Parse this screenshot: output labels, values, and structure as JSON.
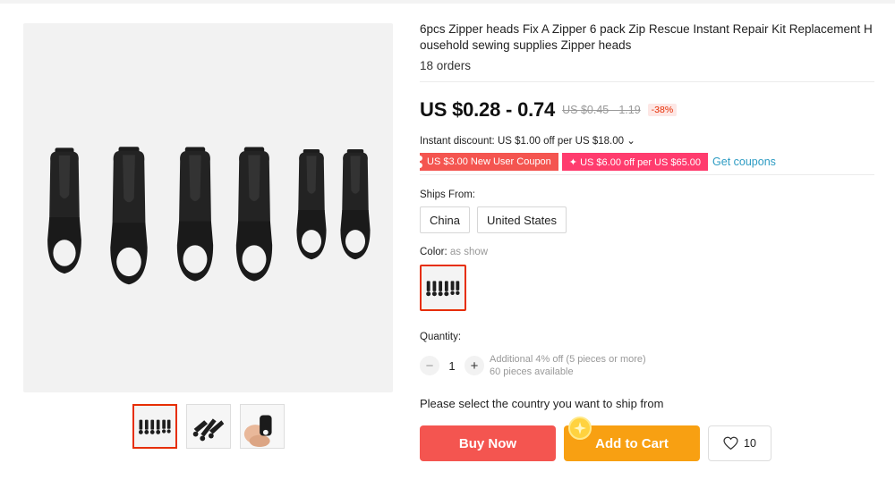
{
  "product": {
    "title": "6pcs Zipper heads Fix A Zipper 6 pack Zip Rescue Instant Repair Kit Replacement Household sewing supplies Zipper heads",
    "orders": "18 orders"
  },
  "gallery": {
    "main_image": "six-black-zipper-pulls",
    "thumbnails": [
      {
        "name": "six-zipper-pulls-thumb",
        "selected": true
      },
      {
        "name": "zipper-pulls-pile-thumb",
        "selected": false
      },
      {
        "name": "zipper-in-hand-thumb",
        "selected": false
      }
    ]
  },
  "pricing": {
    "price": "US $0.28 - 0.74",
    "original_price": "US $0.45 - 1.19",
    "discount_badge": "-38%",
    "instant_discount": "Instant discount: US $1.00 off per US $18.00 ⌄",
    "coupons": [
      "US $3.00 New User Coupon",
      "✦ US $6.00 off per US $65.00"
    ],
    "get_coupons": "Get coupons"
  },
  "shipping": {
    "label": "Ships From:",
    "options": [
      "China",
      "United States"
    ],
    "message": "Please select the country you want to ship from"
  },
  "color": {
    "label": "Color:",
    "value": "as show"
  },
  "quantity": {
    "label": "Quantity:",
    "minus": "−",
    "value": "1",
    "plus": "+",
    "additional_discount": "Additional 4% off (5 pieces or more)",
    "available": "60 pieces available"
  },
  "actions": {
    "buy_now": "Buy Now",
    "add_to_cart": "Add to Cart",
    "wishlist_count": "10"
  },
  "colors": {
    "accent_red": "#e62e04",
    "buy_now": "#f45550",
    "add_to_cart": "#f8a012",
    "link": "#2e9cc3"
  }
}
